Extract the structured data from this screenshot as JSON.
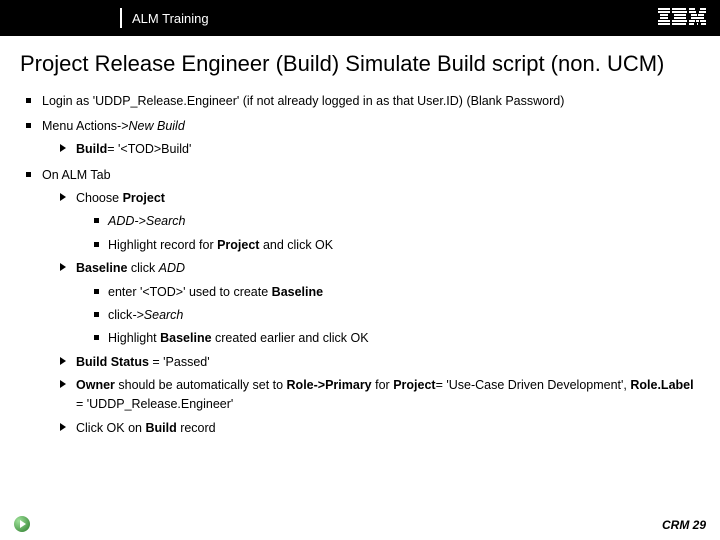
{
  "header": {
    "title": "ALM Training"
  },
  "title": "Project Release Engineer (Build) Simulate Build script (non. UCM)",
  "bullets": {
    "b1": "Login as 'UDDP_Release.Engineer' (if not already logged in as that User.ID) (Blank Password)",
    "b2_pre": "Menu Actions->",
    "b2_it": "New Build",
    "b2_1_pre": "Build",
    "b2_1_post": "= '<TOD>Build'",
    "b3": "On ALM Tab",
    "b3_1_pre": "Choose ",
    "b3_1_bold": "Project",
    "b3_1_1_it": "ADD->Search",
    "b3_1_2_pre": "Highlight record for ",
    "b3_1_2_bold": "Project",
    "b3_1_2_post": " and click OK",
    "b3_2_bold": "Baseline",
    "b3_2_post_pre": " click ",
    "b3_2_post_it": "ADD",
    "b3_2_1_pre": "enter '<TOD>' used to create ",
    "b3_2_1_bold": "Baseline",
    "b3_2_2_pre": "click",
    "b3_2_2_it": "->Search",
    "b3_2_3_pre": "Highlight ",
    "b3_2_3_bold": "Baseline",
    "b3_2_3_post": " created earlier and click OK",
    "b3_3_bold": "Build Status",
    "b3_3_post": " = 'Passed'",
    "b3_4_bold1": "Owner",
    "b3_4_mid1": " should be automatically set to ",
    "b3_4_bold2": "Role->Primary",
    "b3_4_mid2": " for ",
    "b3_4_bold3": "Project",
    "b3_4_mid3": "= 'Use-Case Driven Development', ",
    "b3_4_bold4": "Role.Label",
    "b3_4_post": " = 'UDDP_Release.Engineer'",
    "b3_5_pre": "Click OK on ",
    "b3_5_bold": "Build",
    "b3_5_post": " record"
  },
  "footer": {
    "page": "CRM 29"
  }
}
